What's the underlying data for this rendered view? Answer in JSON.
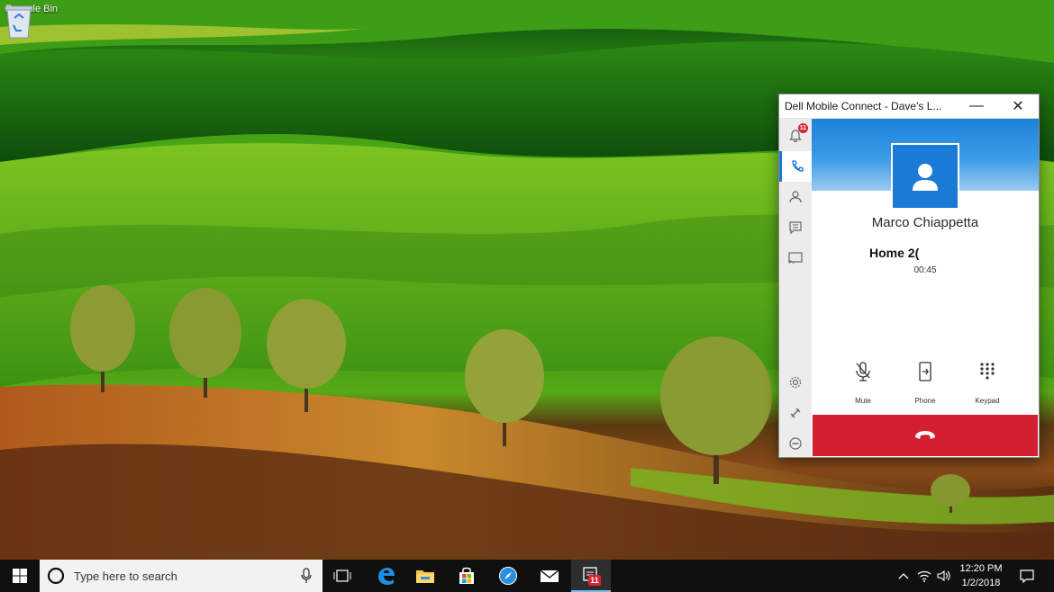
{
  "desktop": {
    "icons": [
      {
        "label": "Recycle Bin",
        "icon": "recycle-bin-icon"
      }
    ]
  },
  "window": {
    "title": "Dell Mobile Connect - Dave's L...",
    "controls": {
      "minimize": "—",
      "close": "✕"
    },
    "sidebar": {
      "items": [
        {
          "name": "notifications",
          "icon": "bell-icon",
          "badge": "11"
        },
        {
          "name": "calls",
          "icon": "phone-icon",
          "active": true
        },
        {
          "name": "contacts",
          "icon": "person-icon"
        },
        {
          "name": "messages",
          "icon": "message-icon"
        },
        {
          "name": "screen-mirror",
          "icon": "cast-icon"
        },
        {
          "name": "settings",
          "icon": "gear-icon"
        },
        {
          "name": "connection",
          "icon": "link-icon"
        },
        {
          "name": "do-not-disturb",
          "icon": "minus-circle-icon"
        }
      ]
    },
    "call": {
      "contact_name": "Marco Chiappetta",
      "line_label": "Home 2(",
      "timer": "00:45",
      "actions": [
        {
          "label": "Mute",
          "icon": "mic-icon"
        },
        {
          "label": "Phone",
          "icon": "phone-transfer-icon"
        },
        {
          "label": "Keypad",
          "icon": "keypad-icon"
        }
      ],
      "hangup_color": "#d31f30"
    }
  },
  "taskbar": {
    "search_placeholder": "Type here to search",
    "badge": "11",
    "time": "12:20 PM",
    "date": "1/2/2018",
    "accent": "#76b9ed"
  }
}
